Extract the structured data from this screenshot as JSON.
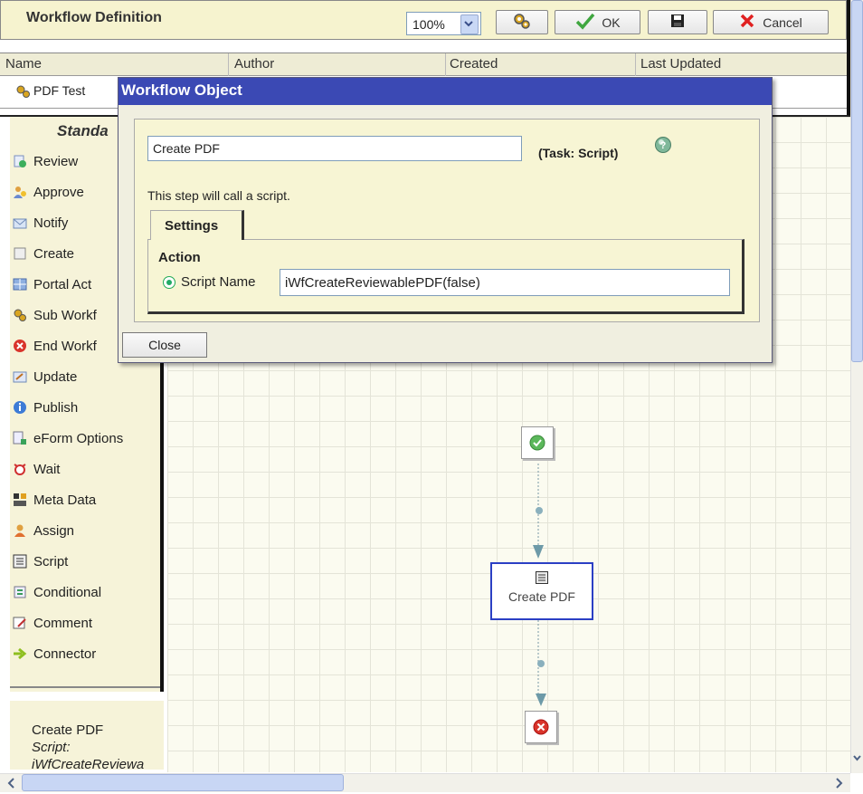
{
  "header": {
    "title": "Workflow Definition",
    "zoom": "100%",
    "ok_label": "OK",
    "cancel_label": "Cancel"
  },
  "grid": {
    "columns": [
      "Name",
      "Author",
      "Created",
      "Last Updated"
    ],
    "row": {
      "name": "PDF Test"
    }
  },
  "sidebar": {
    "title": "Standa",
    "items": [
      {
        "label": "Review",
        "icon": "review-icon"
      },
      {
        "label": "Approve",
        "icon": "approve-icon"
      },
      {
        "label": "Notify",
        "icon": "notify-icon"
      },
      {
        "label": "Create",
        "icon": "create-icon"
      },
      {
        "label": "Portal Act",
        "icon": "portal-action-icon"
      },
      {
        "label": "Sub Workf",
        "icon": "sub-workflow-icon"
      },
      {
        "label": "End Workf",
        "icon": "end-workflow-icon"
      },
      {
        "label": "Update",
        "icon": "update-icon"
      },
      {
        "label": "Publish",
        "icon": "publish-icon"
      },
      {
        "label": "eForm Options",
        "icon": "eform-options-icon"
      },
      {
        "label": "Wait",
        "icon": "wait-icon"
      },
      {
        "label": "Meta Data",
        "icon": "meta-data-icon"
      },
      {
        "label": "Assign",
        "icon": "assign-icon"
      },
      {
        "label": "Script",
        "icon": "script-icon"
      },
      {
        "label": "Conditional",
        "icon": "conditional-icon"
      },
      {
        "label": "Comment",
        "icon": "comment-icon"
      },
      {
        "label": "Connector",
        "icon": "connector-icon"
      }
    ]
  },
  "info": {
    "name": "Create PDF",
    "type": "Script:",
    "detail": "iWfCreateReviewa"
  },
  "dialog": {
    "title": "Workflow Object",
    "name_value": "Create PDF",
    "task_type": "(Task: Script)",
    "description": "This step will call a script.",
    "tab_label": "Settings",
    "action_label": "Action",
    "radio_label": "Script Name",
    "script_value": "iWfCreateReviewablePDF(false)",
    "close_label": "Close"
  },
  "canvas": {
    "node_label": "Create PDF"
  },
  "colors": {
    "header_bg": "#f6f3cf",
    "dialog_title_bg": "#3b49b4",
    "selected_node_border": "#2b3fc4"
  }
}
